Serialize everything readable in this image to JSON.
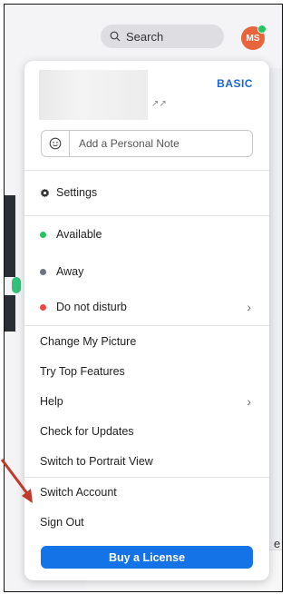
{
  "header": {
    "search_label": "Search",
    "avatar_initials": "MS"
  },
  "profile": {
    "name_suffix": "↗↗",
    "plan": "BASIC"
  },
  "note": {
    "placeholder": "Add a Personal Note"
  },
  "menu": {
    "settings": "Settings",
    "status": [
      {
        "label": "Available",
        "color": "#22c55e"
      },
      {
        "label": "Away",
        "color": "#6b7280"
      },
      {
        "label": "Do not disturb",
        "color": "#ef4444"
      }
    ],
    "change_picture": "Change My Picture",
    "try_top_features": "Try Top Features",
    "help": "Help",
    "check_updates": "Check for Updates",
    "portrait_view": "Switch to Portrait View",
    "switch_account": "Switch Account",
    "sign_out": "Sign Out",
    "buy_license": "Buy a License"
  },
  "background": {
    "edge_text": "e"
  },
  "colors": {
    "accent": "#1473e6",
    "annotation_arrow": "#c0392b"
  }
}
